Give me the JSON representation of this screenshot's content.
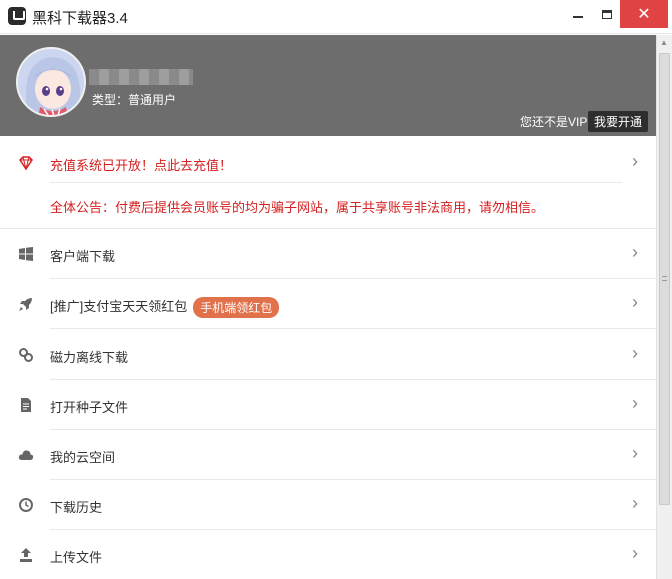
{
  "window": {
    "title": "黑科下载器3.4"
  },
  "header": {
    "user_type": "类型：普通用户",
    "vip_note": "您还不是VIP",
    "vip_button": "我要开通"
  },
  "notice": {
    "title": "充值系统已开放！点此去充值！",
    "announcement": "全体公告：付费后提供会员账号的均为骗子网站，属于共享账号非法商用，请勿相信。"
  },
  "menu": [
    {
      "label": "客户端下载",
      "icon": "windows-icon"
    },
    {
      "label": "[推广]支付宝天天领红包",
      "icon": "rocket-icon",
      "badge": "手机端领红包"
    },
    {
      "label": "磁力离线下载",
      "icon": "link-icon"
    },
    {
      "label": "打开种子文件",
      "icon": "file-icon"
    },
    {
      "label": "我的云空间",
      "icon": "cloud-icon"
    },
    {
      "label": "下载历史",
      "icon": "clock-icon"
    },
    {
      "label": "上传文件",
      "icon": "upload-icon"
    }
  ],
  "colors": {
    "accent_red": "#d42020",
    "header_gray": "#6d6d6d",
    "badge": "#e0714a",
    "close_red": "#e04343"
  }
}
